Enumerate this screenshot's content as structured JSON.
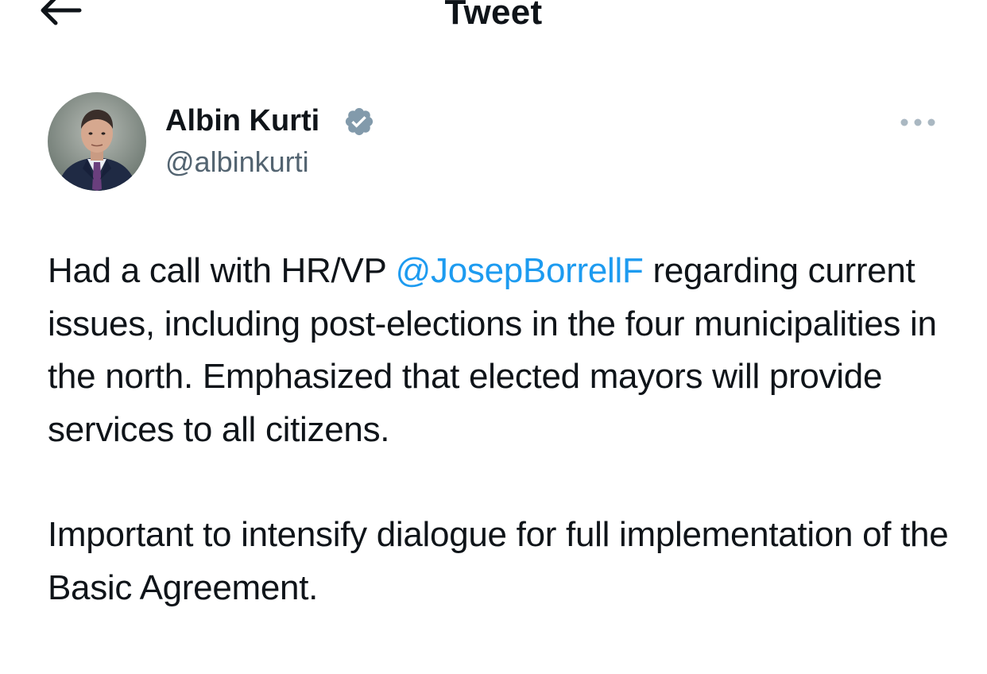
{
  "header": {
    "title": "Tweet",
    "back_icon": "arrow-left-icon"
  },
  "author": {
    "display_name": "Albin Kurti",
    "handle": "@albinkurti",
    "verified_icon": "verified-badge-icon",
    "verified_color": "#829aab"
  },
  "more_icon": "more-options-icon",
  "tweet": {
    "para1": {
      "before": "Had a call with HR/VP ",
      "mention": "@JosepBorrellF",
      "after": " regarding current issues, including post-elections in the four municipalities in the north. Emphasized that elected mayors will provide services to all citizens."
    },
    "para2": "Important to intensify dialogue for full implementation of the Basic Agreement."
  },
  "colors": {
    "text": "#0f1419",
    "secondary": "#536471",
    "link": "#1d9bf0",
    "more_dots": "#aab8c2"
  }
}
